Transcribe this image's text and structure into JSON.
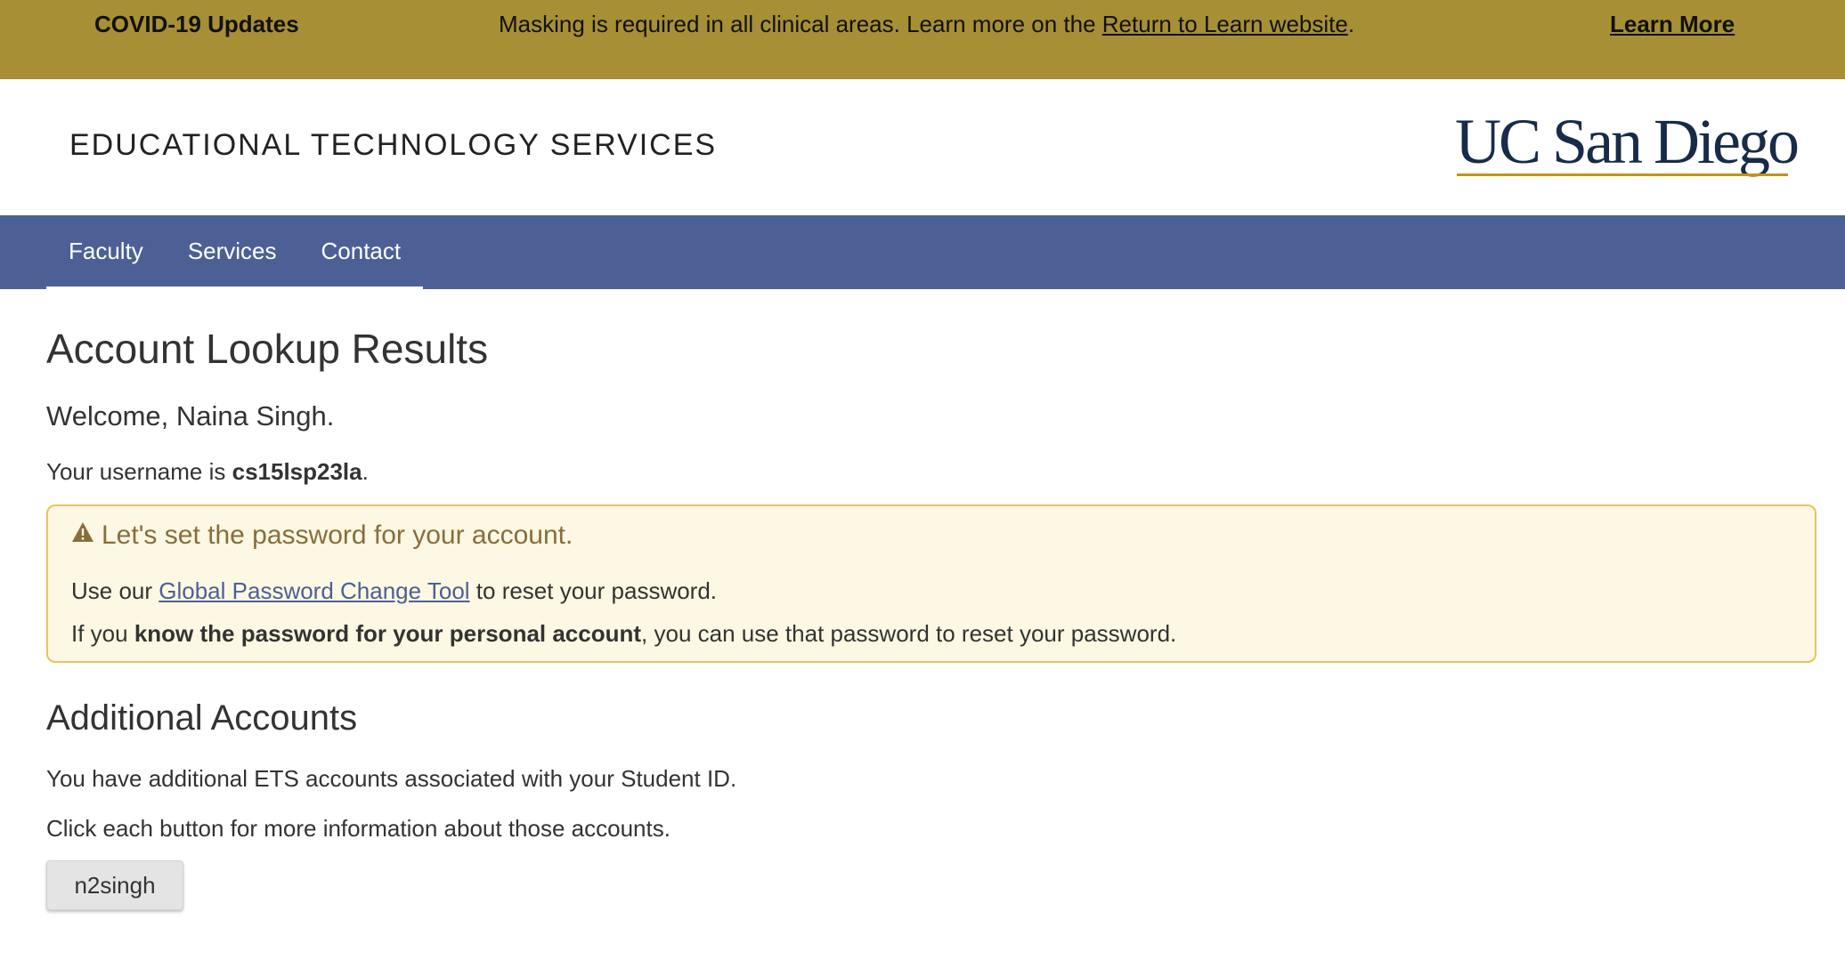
{
  "banner": {
    "title": "COVID-19 Updates",
    "message_prefix": "Masking is required in all clinical areas. Learn more on the ",
    "message_link": "Return to Learn website",
    "message_suffix": ".",
    "learn_more": "Learn More",
    "background_color": "#a68f35"
  },
  "header": {
    "site_title": "EDUCATIONAL TECHNOLOGY SERVICES",
    "logo_text": "UC San Diego"
  },
  "nav": {
    "items": [
      "Faculty",
      "Services",
      "Contact"
    ],
    "background_color": "#4d6095"
  },
  "main": {
    "page_title": "Account Lookup Results",
    "welcome": "Welcome, Naina Singh.",
    "username_prefix": "Your username is ",
    "username": "cs15lsp23la",
    "username_suffix": "."
  },
  "alert": {
    "icon": "warning-icon",
    "heading": "Let's set the password for your account.",
    "line1_prefix": "Use our ",
    "line1_link": "Global Password Change Tool",
    "line1_suffix": " to reset your password.",
    "line2_prefix": "If you ",
    "line2_bold": "know the password for your personal account",
    "line2_suffix": ", you can use that password to reset your password."
  },
  "additional": {
    "title": "Additional Accounts",
    "info1": "You have additional ETS accounts associated with your Student ID.",
    "info2": "Click each button for more information about those accounts.",
    "accounts": [
      "n2singh"
    ]
  }
}
